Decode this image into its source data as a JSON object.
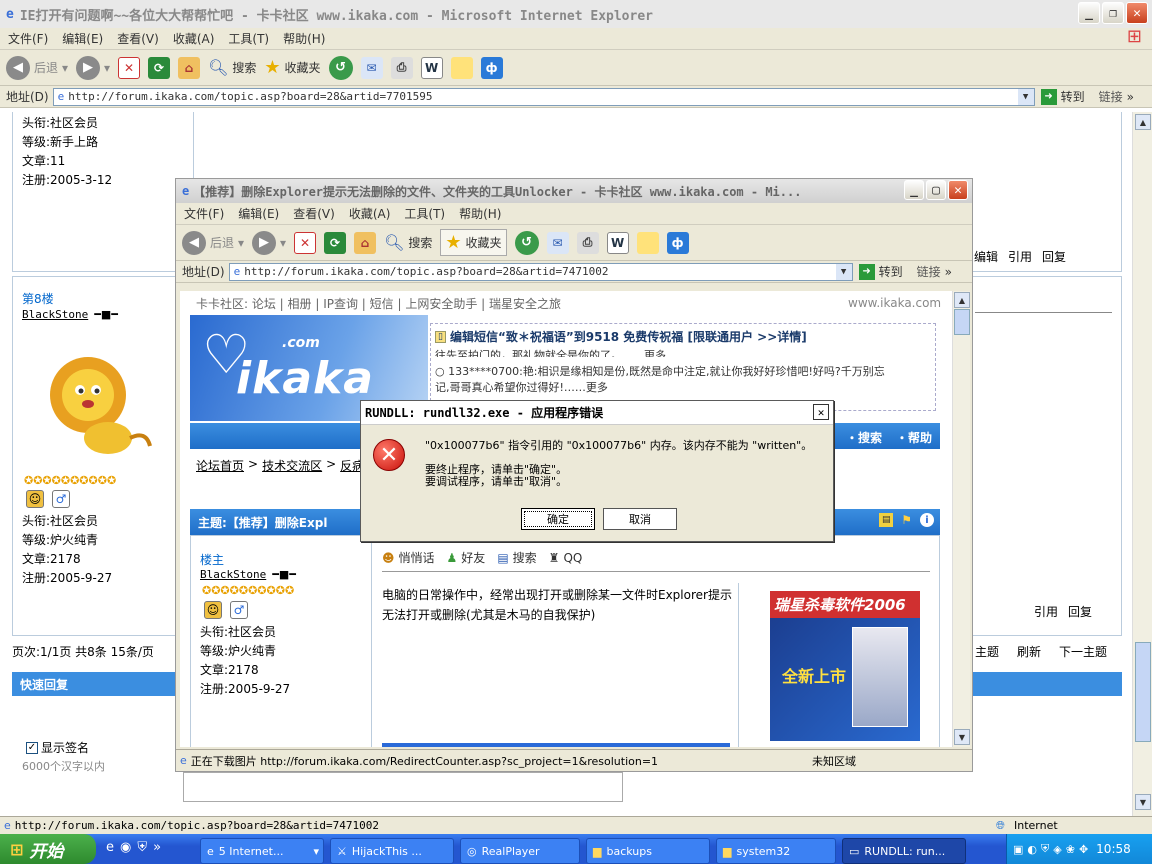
{
  "bg": {
    "title": "IE打开有问题啊~~各位大大帮帮忙吧 - 卡卡社区 www.ikaka.com - Microsoft Internet Explorer",
    "menu": [
      "文件(F)",
      "编辑(E)",
      "查看(V)",
      "收藏(A)",
      "工具(T)",
      "帮助(H)"
    ],
    "toolbar": {
      "back": "后退",
      "search": "搜索",
      "favorites": "收藏夹"
    },
    "address_label": "地址(D)",
    "url": "http://forum.ikaka.com/topic.asp?board=28&artid=7701595",
    "go": "转到",
    "links": "链接",
    "user1": {
      "title": "头衔:社区会员",
      "level": "等级:新手上路",
      "posts": "文章:11",
      "reg": "注册:2005-3-12"
    },
    "floor8": "第8楼",
    "user2": {
      "name": "BlackStone",
      "title": "头衔:社区会员",
      "level": "等级:炉火纯青",
      "posts": "文章:2178",
      "reg": "注册:2005-9-27"
    },
    "edit": "编辑",
    "quote": "引用",
    "reply": "回复",
    "pager": "页次:1/1页 共8条 15条/页",
    "nav": {
      "topic": "主题",
      "refresh": "刷新",
      "next": "下一主题"
    },
    "quick_reply": "快速回复",
    "show_sig": "显示签名",
    "sig_limit": "6000个汉字以内",
    "status_url": "http://forum.ikaka.com/topic.asp?board=28&artid=7471002",
    "status_zone": "Internet"
  },
  "fg": {
    "title": "【推荐】删除Explorer提示无法删除的文件、文件夹的工具Unlocker - 卡卡社区 www.ikaka.com - Mi...",
    "menu": [
      "文件(F)",
      "编辑(E)",
      "查看(V)",
      "收藏(A)",
      "工具(T)",
      "帮助(H)"
    ],
    "toolbar": {
      "back": "后退",
      "search": "搜索",
      "favorites": "收藏夹"
    },
    "address_label": "地址(D)",
    "url": "http://forum.ikaka.com/topic.asp?board=28&artid=7471002",
    "go": "转到",
    "links": "链接",
    "topnav": "卡卡社区: 论坛 | 相册 | IP查询 | 短信 | 上网安全助手 | 瑞星安全之旅",
    "site": "www.ikaka.com",
    "logo": "ikaka",
    "logo_com": ".com",
    "promo": "编辑短信“致＊祝福语”到9518 免费传祝福 [限联通用户 >>详情]",
    "msg_partial": "往先至拍门的，那礼物就全是你的了。……更多",
    "msg2": "133****0700:艳:相识是缘相知是份,既然是命中注定,就让你我好好珍惜吧!好吗?千万别忘",
    "msg3": "记,哥哥真心希望你过得好!……更多",
    "bar_search": "・搜索",
    "bar_help": "・帮助",
    "crumbs": [
      "论坛首页",
      "技术交流区",
      "反病"
    ],
    "topic_label": "主题:【推荐】删除Expl",
    "floor": "楼主",
    "user": {
      "name": "BlackStone",
      "title": "头衔:社区会员",
      "level": "等级:炉火纯青",
      "posts": "文章:2178",
      "reg": "注册:2005-9-27"
    },
    "actions": [
      "悄悄话",
      "好友",
      "搜索",
      "QQ"
    ],
    "post": "电脑的日常操作中，经常出现打开或删除某一文件时Explorer提示无法打开或删除(尤其是木马的自我保护)",
    "ad_title": "瑞星杀毒软件2006",
    "ad_sub": "全新上市",
    "status": "正在下载图片 http://forum.ikaka.com/RedirectCounter.asp?sc_project=1&resolution=1",
    "zone": "未知区域"
  },
  "dialog": {
    "title": "RUNDLL: rundll32.exe - 应用程序错误",
    "line1": "\"0x100077b6\" 指令引用的 \"0x100077b6\" 内存。该内存不能为 \"written\"。",
    "line2": "要终止程序，请单击\"确定\"。",
    "line3": "要调试程序，请单击\"取消\"。",
    "ok": "确定",
    "cancel": "取消"
  },
  "taskbar": {
    "start": "开始",
    "items": [
      "5 Internet...",
      "HijackThis ...",
      "RealPlayer",
      "backups",
      "system32",
      "RUNDLL: run..."
    ],
    "clock": "10:58"
  }
}
